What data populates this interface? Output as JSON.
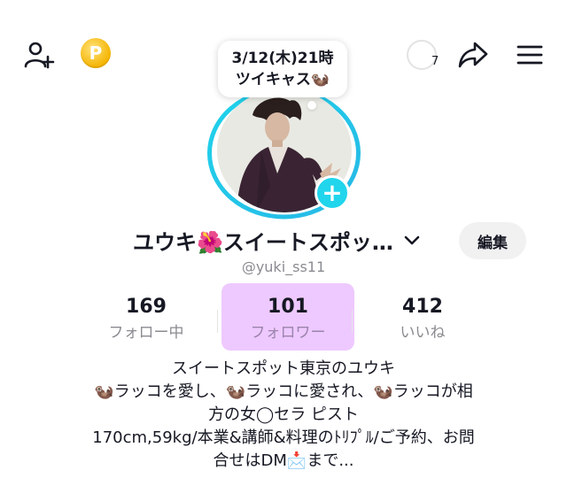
{
  "header": {
    "icons": [
      "add-friend-icon",
      "coin-icon",
      "progress-ring-icon",
      "share-icon",
      "menu-icon"
    ],
    "coin_glyph": "P",
    "ring_count": "7"
  },
  "bubble": {
    "line1": "3/12(木)21時",
    "line2": "ツイキャス🦦"
  },
  "profile": {
    "name": "ユウキ🌺スイートスポッ…",
    "handle": "@yuki_ss11",
    "edit_label": "編集",
    "plus_glyph": "+"
  },
  "stats": [
    {
      "value": "169",
      "label": "フォロー中"
    },
    {
      "value": "101",
      "label": "フォロワー"
    },
    {
      "value": "412",
      "label": "いいね"
    }
  ],
  "bio": {
    "lines": [
      "スイートスポット東京のユウキ",
      "🦦ラッコを愛し、🦦ラッコに愛され、🦦ラッコが相",
      "方の女◯セラ ピスト",
      "170cm,59kg/本業&講師&料理のﾄﾘﾌﾟﾙ/ご予約、お問",
      "合せはDM📩まで..."
    ]
  },
  "colors": {
    "accent_ring": "#20d5ec",
    "highlight": "#eec9ff",
    "coin": "#f5b400"
  }
}
